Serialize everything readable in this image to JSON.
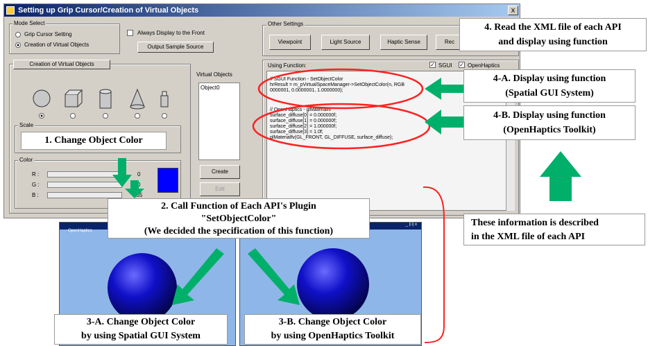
{
  "window": {
    "title": "Setting up Grip Cursor/Creation of Virtual Objects",
    "close_glyph": "x",
    "mode_select": {
      "label": "Mode Select",
      "options": [
        "Grip Cursor Setting",
        "Creation of Virtual Objects"
      ],
      "selected": 1
    },
    "always_front_label": "Always Display to the Front",
    "output_button": "Output Sample Source",
    "creation_label": "Creation of Virtual Objects",
    "shapes": [
      "sphere-icon",
      "cube-icon",
      "cylinder-icon",
      "cone-icon",
      "teapot-icon"
    ],
    "scale_label": "Scale",
    "color_label": "Color",
    "color_channels": [
      {
        "label": "R :",
        "value": "0"
      },
      {
        "label": "G :",
        "value": "0"
      },
      {
        "label": "B :",
        "value": "255"
      }
    ],
    "swatch_color": "#0000ff",
    "virtual_objects_label": "Virtual Objects",
    "objects": [
      "Object0"
    ],
    "create_button": "Create",
    "edit_button": "Edit",
    "other_settings": {
      "label": "Other Settings",
      "buttons": [
        "Viewpoint",
        "Light Source",
        "Haptic Sense",
        "Rec"
      ]
    },
    "using_function_label": "Using Function:",
    "api_checks": [
      "SGUI",
      "OpenHaptics"
    ],
    "code_lines": [
      "// SGUI Function - SetObjectColor",
      "hrResult = m_pVirtualSpaceManager->SetObjectColor(n, RGB",
      "0000001, 0.0000001, 1.0000000);",
      "",
      "// OpenHaptics - glMaterialfv",
      "surface_diffuse[0] = 0.000000f;",
      "surface_diffuse[1] = 0.000000f;",
      "surface_diffuse[2] = 1.000000f;",
      "surface_diffuse[3] = 1.0f;",
      "glMaterialfv(GL_FRONT, GL_DIFFUSE, surface_diffuse);"
    ]
  },
  "oh_window_title": "OpenHaptics",
  "oh_window_controls": "_ |□| x",
  "callouts": {
    "step1": "1. Change Object Color",
    "step2": [
      "2. Call Function of Each API's Plugin",
      "\"SetObjectColor\"",
      "(We decided the specification of this function)"
    ],
    "step3a": [
      "3-A. Change Object Color",
      "by using Spatial GUI System"
    ],
    "step3b": [
      "3-B. Change Object Color",
      "by using OpenHaptics Toolkit"
    ],
    "step4": [
      "4. Read the XML file of each API",
      "and display using function"
    ],
    "step4a": [
      "4-A. Display using function",
      "(Spatial GUI System)"
    ],
    "step4b": [
      "4-B. Display using function",
      "(OpenHaptics Toolkit)"
    ],
    "xml_note": [
      "These information is described",
      "in the XML file of each API"
    ]
  },
  "colors": {
    "arrow": "#00b06a",
    "ellipse": "#ff2020",
    "bracket": "#ff2020",
    "sphere": "#1010c8"
  }
}
